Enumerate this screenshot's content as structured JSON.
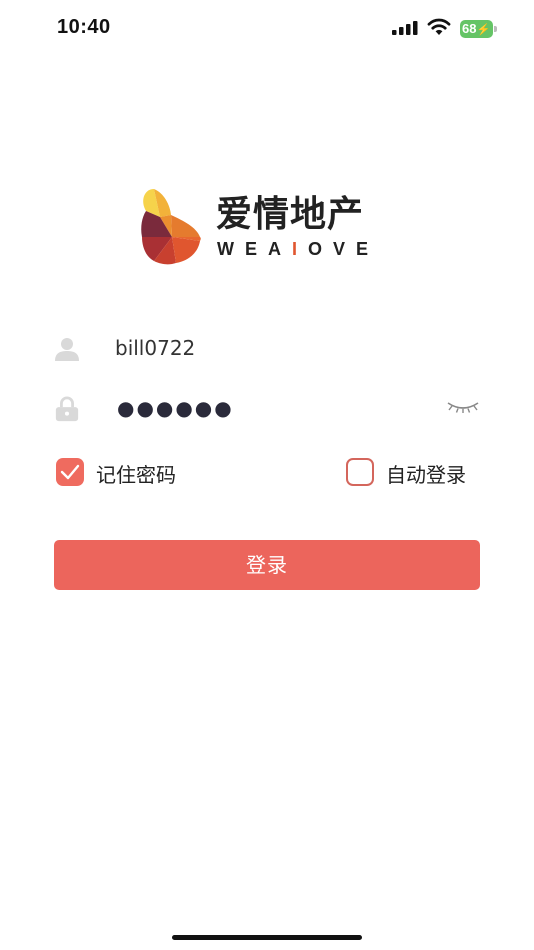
{
  "status_bar": {
    "time": "10:40",
    "battery_level": "68",
    "icons": [
      "cellular-signal-icon",
      "wifi-icon",
      "battery-charging-icon"
    ]
  },
  "logo": {
    "title": "爱情地产",
    "subtitle_parts": [
      "WEA",
      "I",
      "OVE"
    ],
    "accent_color": "#e0562f"
  },
  "form": {
    "username": {
      "icon": "user-icon",
      "value": "bill0722"
    },
    "password": {
      "icon": "lock-icon",
      "masked_value": "●●●●●●",
      "toggle_icon": "eye-closed-icon"
    },
    "remember_password": {
      "label": "记住密码",
      "checked": true
    },
    "auto_login": {
      "label": "自动登录",
      "checked": false
    },
    "submit_label": "登录"
  },
  "colors": {
    "primary": "#ec655c",
    "checkbox_checked": "#ef6b5f",
    "battery_green": "#65c466"
  }
}
